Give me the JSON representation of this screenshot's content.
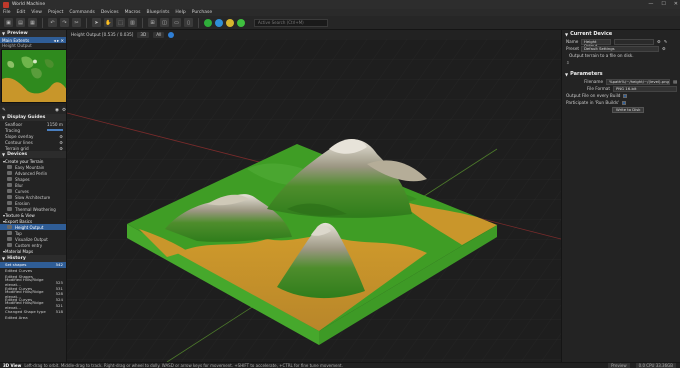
{
  "window": {
    "title": "World Machine",
    "controls": [
      "—",
      "☐",
      "✕"
    ]
  },
  "menu": [
    "File",
    "Edit",
    "View",
    "Project",
    "Commands",
    "Devices",
    "Macros",
    "Blueprints",
    "Help",
    "Purchase"
  ],
  "toolbar": {
    "search_placeholder": "Active Search (Ctrl+M)"
  },
  "left": {
    "preview": {
      "title": "Preview",
      "source": "Main Extents",
      "subtitle": "Height Output"
    },
    "display_guides": {
      "title": "Display Guides",
      "rows": [
        {
          "label": "Seafloor",
          "value": "1150 m"
        },
        {
          "label": "Tracing",
          "value": ""
        },
        {
          "label": "Slope overlay",
          "value": ""
        },
        {
          "label": "Contour lines",
          "value": ""
        },
        {
          "label": "Terrain grid",
          "value": ""
        }
      ]
    },
    "devices": {
      "title": "Devices",
      "items": [
        {
          "label": "Create your Terrain",
          "kind": "cat"
        },
        {
          "label": "Easy Mountain",
          "kind": "item"
        },
        {
          "label": "Advanced Perlin",
          "kind": "item"
        },
        {
          "label": "Shapes",
          "kind": "item"
        },
        {
          "label": "Blur",
          "kind": "item"
        },
        {
          "label": "Curves",
          "kind": "item"
        },
        {
          "label": "Slow Architecture",
          "kind": "item"
        },
        {
          "label": "Erosion",
          "kind": "item"
        },
        {
          "label": "Thermal Weathering",
          "kind": "item"
        },
        {
          "label": "Texture & View",
          "kind": "cat"
        },
        {
          "label": "Export Basics",
          "kind": "cat"
        },
        {
          "label": "Height Output",
          "kind": "sel"
        },
        {
          "label": "Tap",
          "kind": "item"
        },
        {
          "label": "Visualize Output",
          "kind": "item"
        },
        {
          "label": "Custom entry",
          "kind": "item"
        },
        {
          "label": "Material Maps",
          "kind": "cat"
        }
      ]
    },
    "history": {
      "title": "History",
      "items": [
        {
          "label": "Set shapes",
          "value": "542",
          "sel": true
        },
        {
          "label": "Edited Curves",
          "value": ""
        },
        {
          "label": "Edited Shapes",
          "value": ""
        },
        {
          "label": "Modified Hills/Ridge elevat…",
          "value": "525"
        },
        {
          "label": "Edited Curves",
          "value": "531"
        },
        {
          "label": "Modified Hills/Ridge elevat…",
          "value": "528"
        },
        {
          "label": "Edited Curves",
          "value": "524"
        },
        {
          "label": "Modified Hills/Ridge elevat…",
          "value": "521"
        },
        {
          "label": "Changed Shape type",
          "value": "518"
        },
        {
          "label": "Edited Area",
          "value": ""
        }
      ]
    }
  },
  "viewport": {
    "header": "Height Output [0.535 / 0.035]",
    "mode": "3D",
    "all": "All"
  },
  "right": {
    "current_device": {
      "title": "Current Device",
      "name_label": "Name",
      "name_value": "Height Output",
      "preset_label": "Preset",
      "preset_value": "Default Settings",
      "description": "Output terrain to a file on disk."
    },
    "parameters": {
      "title": "Parameters",
      "filename_label": "Filename",
      "filename_value": "%path%/~/height/~/(level).png",
      "format_label": "File Format",
      "format_value": "PNG 16-bit",
      "check1": "Output File on every Build",
      "check2": "Participate in 'Run Builds'",
      "write_button": "Write to Disk"
    }
  },
  "status": {
    "mode": "3D View",
    "hint": "Left-drag to orbit. Middle-drag to track. Right-drag or wheel to dolly. WASD or arrow keys for movement. +SHIFT to accelerate, +CTRL for fine tune movement.",
    "preview": "Preview",
    "cpu": "0.0 CPU 33.36GB"
  },
  "colors": {
    "accent": "#2f5d96",
    "grass": "#3e9a26",
    "sand": "#c8962a"
  }
}
